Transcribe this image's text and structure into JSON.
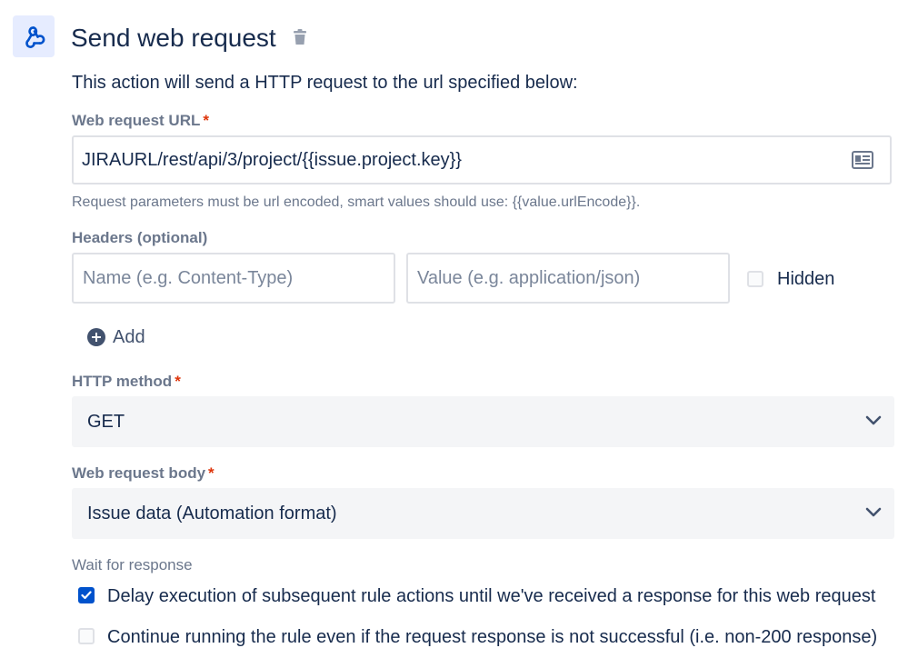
{
  "header": {
    "title": "Send web request",
    "icon": "webhook-icon",
    "delete_icon": "trash-icon"
  },
  "description": "This action will send a HTTP request to the url specified below:",
  "url_section": {
    "label": "Web request URL",
    "required_marker": "*",
    "value": "JIRAURL/rest/api/3/project/{{issue.project.key}}",
    "smart_value_icon": "smart-value-icon",
    "hint": "Request parameters must be url encoded, smart values should use: {{value.urlEncode}}."
  },
  "headers_section": {
    "label": "Headers (optional)",
    "name_placeholder": "Name (e.g. Content-Type)",
    "value_placeholder": "Value (e.g. application/json)",
    "hidden_label": "Hidden",
    "hidden_checked": false,
    "add_label": "Add"
  },
  "method_section": {
    "label": "HTTP method",
    "required_marker": "*",
    "selected": "GET"
  },
  "body_section": {
    "label": "Web request body",
    "required_marker": "*",
    "selected": "Issue data (Automation format)"
  },
  "wait_section": {
    "label": "Wait for response",
    "options": [
      {
        "label": "Delay execution of subsequent rule actions until we've received a response for this web request",
        "checked": true
      },
      {
        "label": "Continue running the rule even if the request response is not successful (i.e. non-200 response)",
        "checked": false
      }
    ]
  },
  "colors": {
    "accent": "#0052cc",
    "text": "#172b4d",
    "subtle": "#6b778c",
    "required": "#de350b",
    "field_bg": "#f4f5f7",
    "icon_bg": "#e6ecff"
  }
}
